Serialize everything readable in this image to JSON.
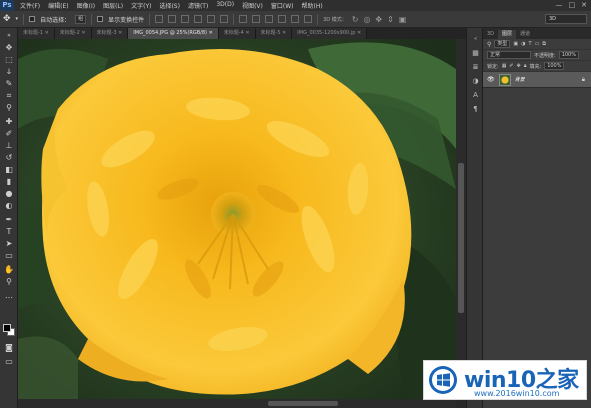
{
  "app": {
    "logo_text": "Ps"
  },
  "menubar": {
    "items": [
      "文件(F)",
      "编辑(E)",
      "图像(I)",
      "图层(L)",
      "文字(Y)",
      "选择(S)",
      "滤镜(T)",
      "3D(D)",
      "视图(V)",
      "窗口(W)",
      "帮助(H)"
    ],
    "window_controls": [
      "—",
      "□",
      "✕"
    ]
  },
  "options_bar": {
    "auto_select_label": "自动选择：",
    "auto_select_value": "组",
    "show_transform_label": "显示变换控件",
    "mode_3d_label": "3D 模式：",
    "workspace_value": "3D"
  },
  "document_tabs": [
    {
      "label": "未标题-1 ✕",
      "active": false
    },
    {
      "label": "未标题-2 ✕",
      "active": false
    },
    {
      "label": "未标题-3 ✕",
      "active": false
    },
    {
      "label": "IMG_0054.JPG @ 25%(RGB/8) ✕",
      "active": true
    },
    {
      "label": "未标题-4 ✕",
      "active": false
    },
    {
      "label": "未标题-5 ✕",
      "active": false
    },
    {
      "label": "IMG_0035-1200x900.jp ✕",
      "active": false
    }
  ],
  "layers_panel": {
    "tabs": [
      "3D",
      "图层",
      "通道"
    ],
    "filter_label": "类型",
    "blend_mode": "正常",
    "opacity_label": "不透明度:",
    "opacity_value": "100%",
    "lock_label": "锁定:",
    "fill_label": "填充:",
    "fill_value": "100%",
    "layer_name": "背景"
  },
  "colors": {
    "foreground": "#000000",
    "background": "#ffffff",
    "flower": "#f4b81c",
    "leaves": "#2f5a2a"
  },
  "watermark": {
    "title": "win10之家",
    "url": "www.2016win10.com"
  }
}
